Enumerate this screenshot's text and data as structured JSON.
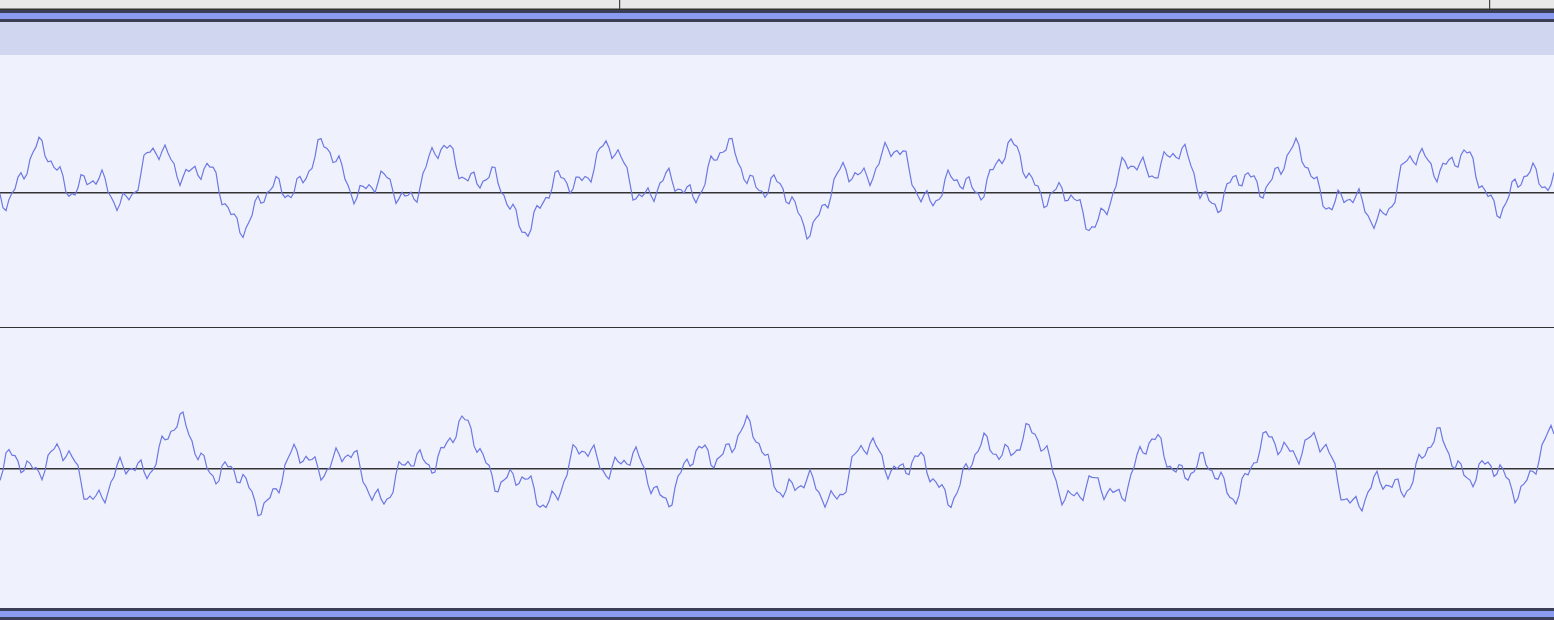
{
  "clip": {
    "channels": [
      {
        "kind": "waveform"
      },
      {
        "kind": "waveform"
      }
    ]
  }
}
